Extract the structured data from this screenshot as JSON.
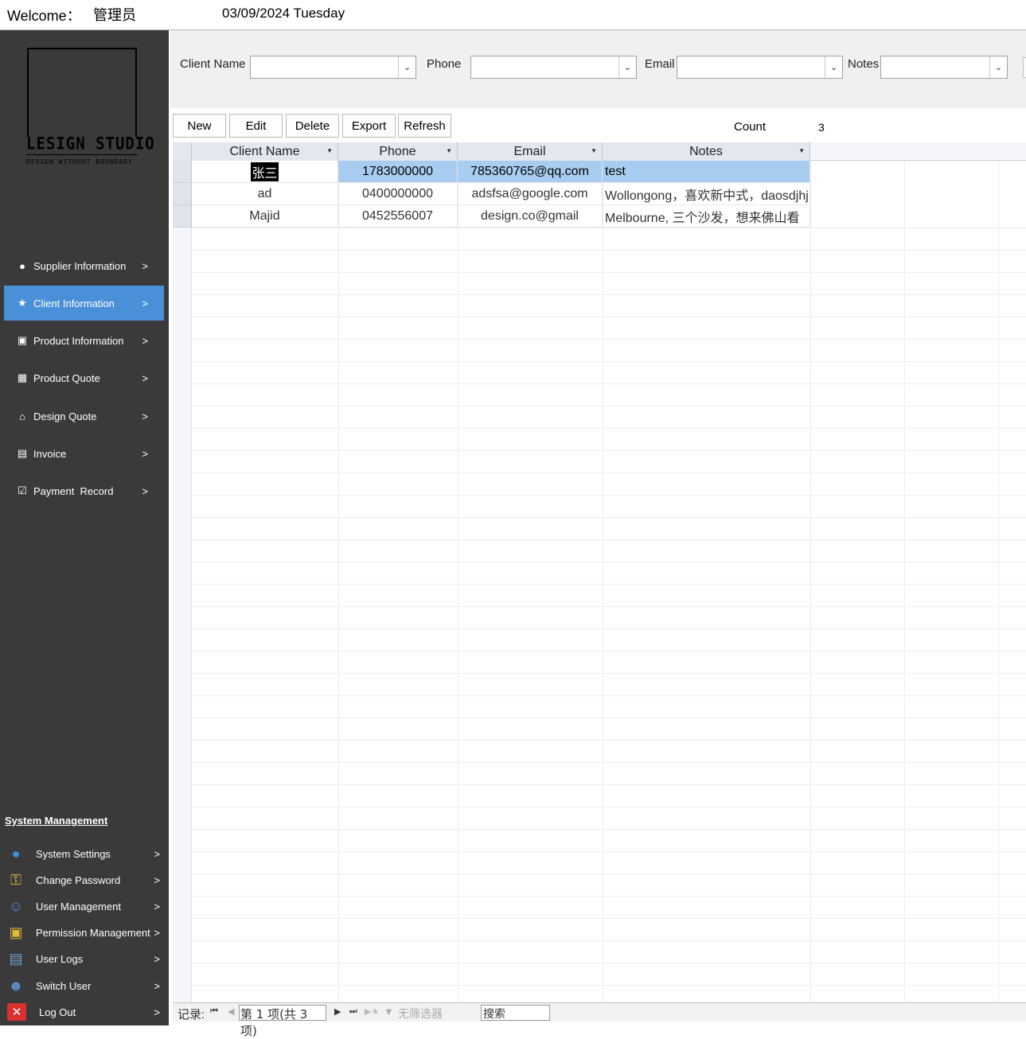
{
  "header": {
    "welcome": "Welcome：",
    "user": "管理员",
    "date": "03/09/2024 Tuesday"
  },
  "logo": {
    "title": "LESIGN  STUDIO",
    "tagline": "DESIGN  WITHOUT  BOUNDARY"
  },
  "nav": [
    {
      "label": "Supplier Information",
      "icon": "globe-icon",
      "glyph": "●",
      "arrow": ">"
    },
    {
      "label": "Client Information",
      "icon": "folder-star-icon",
      "glyph": "★",
      "arrow": ">",
      "active": true
    },
    {
      "label": "Product Information",
      "icon": "hierarchy-icon",
      "glyph": "▣",
      "arrow": ">"
    },
    {
      "label": "Product Quote",
      "icon": "table-icon",
      "glyph": "▦",
      "arrow": ">"
    },
    {
      "label": "Design Quote",
      "icon": "home-icon",
      "glyph": "⌂",
      "arrow": ">"
    },
    {
      "label": "Invoice",
      "icon": "invoice-icon",
      "glyph": "▤",
      "arrow": ">"
    },
    {
      "label": "Payment  Record",
      "icon": "clipboard-icon",
      "glyph": "☑",
      "arrow": ">"
    }
  ],
  "system": {
    "title": "System Management",
    "items": [
      {
        "label": "System Settings",
        "icon": "globe-icon",
        "glyph": "●",
        "arrow": ">"
      },
      {
        "label": "Change Password",
        "icon": "key-icon",
        "glyph": "⚿",
        "arrow": ">"
      },
      {
        "label": "User Management",
        "icon": "users-icon",
        "glyph": "☺",
        "arrow": ">"
      },
      {
        "label": "Permission Management",
        "icon": "lock-icon",
        "glyph": "▣",
        "arrow": ">"
      },
      {
        "label": "User Logs",
        "icon": "log-icon",
        "glyph": "▤",
        "arrow": ">"
      },
      {
        "label": "Switch User",
        "icon": "switch-user-icon",
        "glyph": "☻",
        "arrow": ">"
      },
      {
        "label": "Log Out",
        "icon": "close-icon",
        "glyph": "✕",
        "arrow": ">"
      }
    ]
  },
  "filters": {
    "client_name_label": "Client Name",
    "client_name_value": "",
    "phone_label": "Phone",
    "phone_value": "",
    "email_label": "Email",
    "email_value": "",
    "notes_label": "Notes",
    "notes_value": ""
  },
  "toolbar": {
    "new": "New",
    "edit": "Edit",
    "delete": "Delete",
    "export": "Export",
    "refresh": "Refresh",
    "count_label": "Count",
    "count_value": "3"
  },
  "grid": {
    "columns": [
      "Client Name",
      "Phone",
      "Email",
      "Notes"
    ],
    "rows": [
      [
        "张三",
        "1783000000",
        "785360765@qq.com",
        "test"
      ],
      [
        "ad",
        "0400000000",
        "adsfsa@google.com",
        "Wollongong，喜欢新中式，daosdjhj"
      ],
      [
        "Majid",
        "0452556007",
        "design.co@gmail",
        "Melbourne, 三个沙发，想来佛山看"
      ]
    ]
  },
  "navbar": {
    "record_label": "记录:",
    "position": "第 1 项(共 3 项)",
    "no_filter": "无筛选器",
    "search": "搜索"
  },
  "colors": {
    "sidebar_bg": "#3a3a3a",
    "active_nav": "#4a90d9",
    "selection": "#a8cdf0"
  }
}
